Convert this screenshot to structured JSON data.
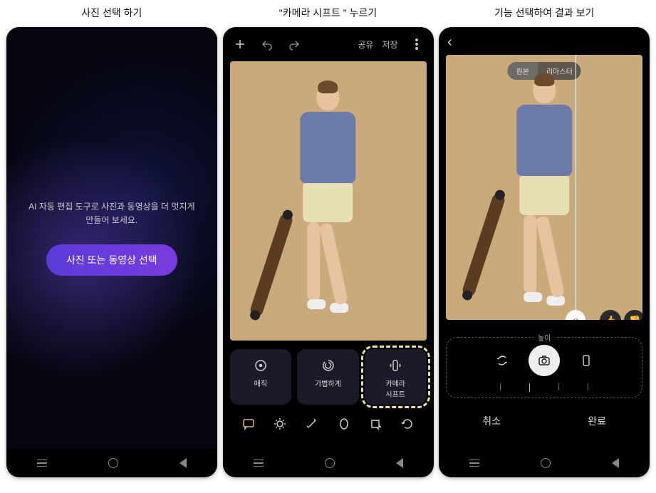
{
  "captions": {
    "s1": "사진 선택 하기",
    "s2": "\"카메라 시프트 \" 누르기",
    "s3": "기능 선택하여 결과 보기"
  },
  "screen1": {
    "promo_line1": "AI 자동 편집 도구로 사진과 동영상을 더 멋지게",
    "promo_line2": "만들어 보세요.",
    "cta": "사진 또는 동영상 선택"
  },
  "screen2": {
    "share": "공유",
    "save": "저장",
    "tools": [
      {
        "label": "매직",
        "icon": "target"
      },
      {
        "label": "가볍하게",
        "icon": "swirl"
      },
      {
        "label": "카메라\n시프트",
        "icon": "phone-rotate"
      }
    ]
  },
  "screen3": {
    "tabs": {
      "left": "원본",
      "right": "리마스터"
    },
    "adjust_label": "높이",
    "cancel": "취소",
    "done": "완료"
  }
}
